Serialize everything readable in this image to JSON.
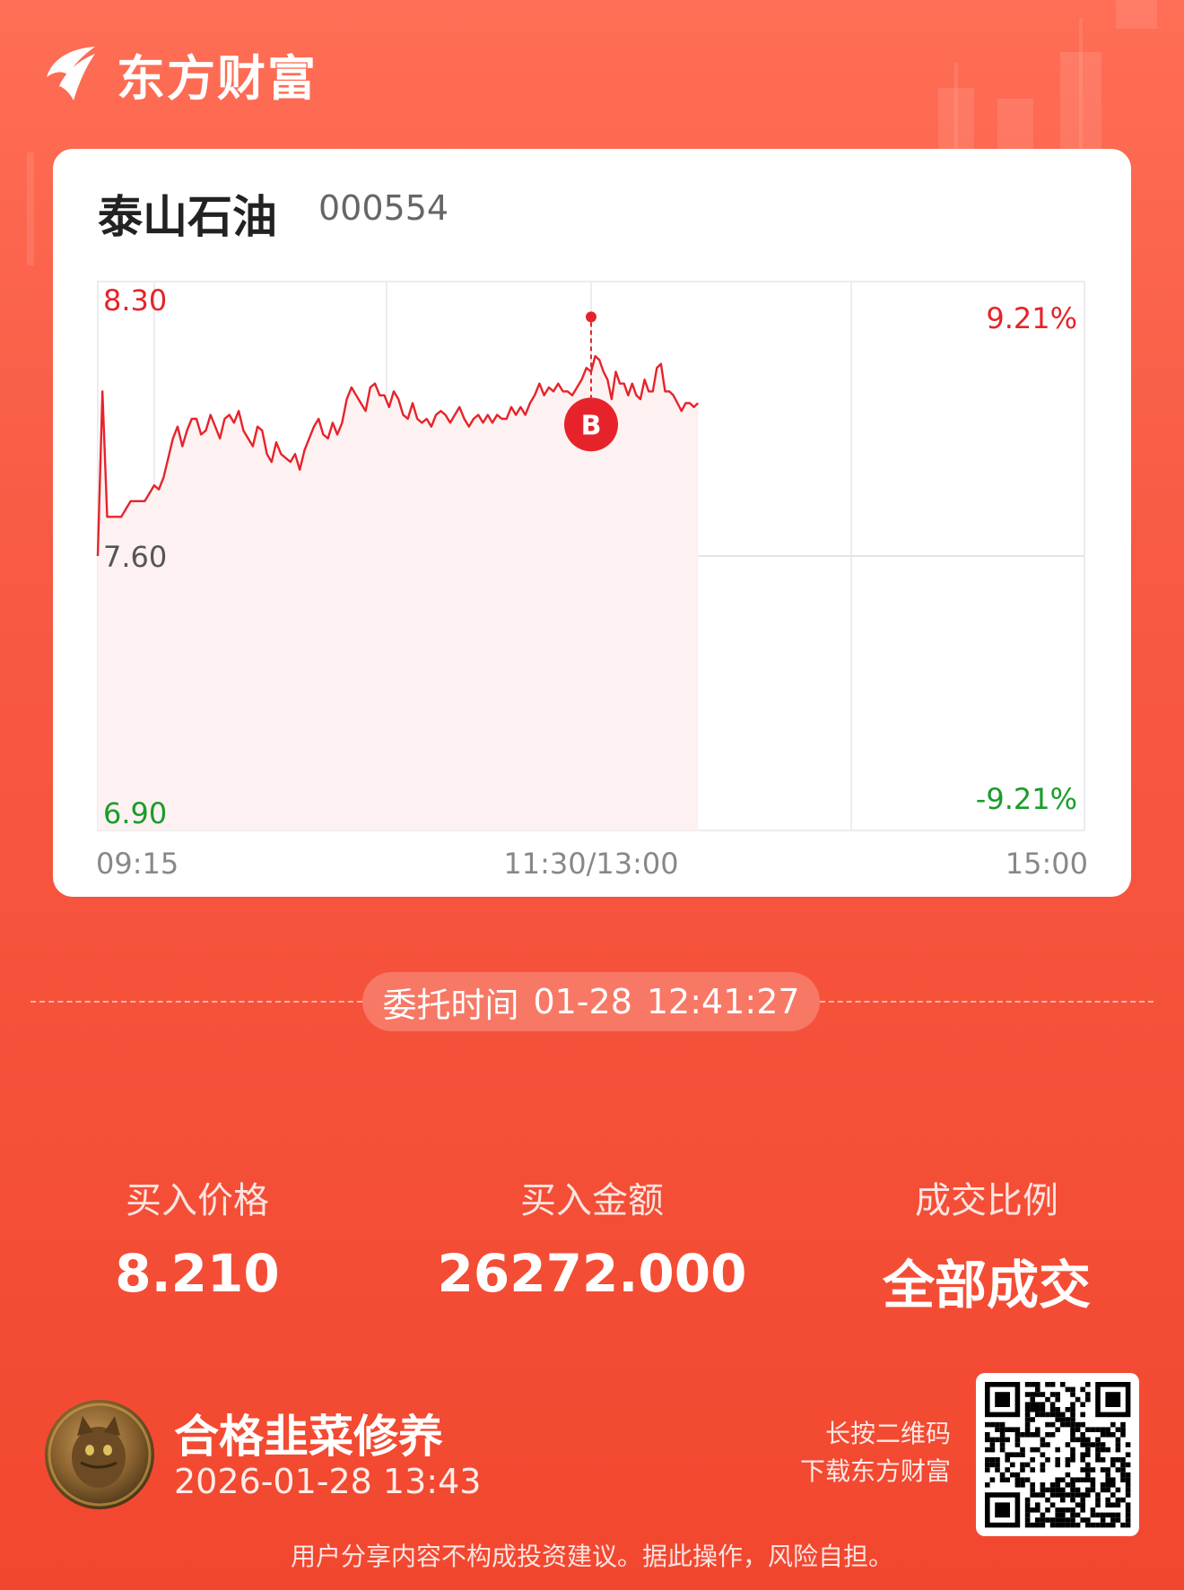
{
  "brand": {
    "name": "东方财富",
    "logo_icon": "eastmoney-logo-icon"
  },
  "stock": {
    "name": "泰山石油",
    "code": "000554"
  },
  "chart_data": {
    "type": "line",
    "title": "",
    "y_left_ticks": [
      "8.30",
      "7.60",
      "6.90"
    ],
    "y_right_ticks": [
      "9.21%",
      "-9.21%"
    ],
    "x_ticks": [
      "09:15",
      "11:30/13:00",
      "15:00"
    ],
    "ylim": [
      6.9,
      8.3
    ],
    "pre_close": 7.6,
    "colors": {
      "up": "#e6232b",
      "down": "#1a9c2a",
      "neutral": "#555555",
      "fill": "#fdf1f1",
      "grid": "#ececec"
    },
    "series": [
      {
        "values": [
          7.6,
          8.02,
          7.7,
          7.7,
          7.7,
          7.7,
          7.72,
          7.74,
          7.74,
          7.74,
          7.74,
          7.76,
          7.78,
          7.77,
          7.8,
          7.85,
          7.9,
          7.93,
          7.88,
          7.92,
          7.95,
          7.95,
          7.91,
          7.92,
          7.96,
          7.93,
          7.9,
          7.95,
          7.96,
          7.94,
          7.97,
          7.92,
          7.9,
          7.88,
          7.93,
          7.92,
          7.86,
          7.84,
          7.89,
          7.86,
          7.85,
          7.84,
          7.86,
          7.82,
          7.87,
          7.9,
          7.93,
          7.95,
          7.91,
          7.9,
          7.94,
          7.91,
          7.94,
          8.0,
          8.03,
          8.01,
          7.99,
          7.97,
          8.03,
          8.04,
          8.01,
          8.01,
          7.98,
          8.02,
          8.0,
          7.96,
          7.95,
          7.99,
          7.95,
          7.94,
          7.95,
          7.93,
          7.96,
          7.97,
          7.96,
          7.94,
          7.96,
          7.98,
          7.95,
          7.93,
          7.95,
          7.96,
          7.94,
          7.96,
          7.94,
          7.96,
          7.95,
          7.95,
          7.98,
          7.96,
          7.98,
          7.96,
          7.99,
          8.01,
          8.04,
          8.01,
          8.03,
          8.02,
          8.04,
          8.02,
          8.02,
          8.01,
          8.03,
          8.05,
          8.08,
          8.07,
          8.11,
          8.1,
          8.07,
          8.05,
          8.0,
          8.07,
          8.04,
          8.04,
          8.01,
          8.04,
          8.01,
          8.0,
          8.05,
          8.02,
          8.02,
          8.08,
          8.09,
          8.02,
          8.02,
          8.01,
          7.99,
          7.97,
          7.99,
          7.99,
          7.98,
          7.99
        ],
        "markers": [
          {
            "label": "B",
            "index": 105,
            "price": 8.21
          }
        ]
      }
    ],
    "session": {
      "morning_points": 106,
      "afternoon_points_total": 120
    }
  },
  "order": {
    "label": "委托时间",
    "date": "01-28",
    "time": "12:41:27"
  },
  "stats": [
    {
      "label": "买入价格",
      "value": "8.210"
    },
    {
      "label": "买入金额",
      "value": "26272.000"
    },
    {
      "label": "成交比例",
      "value": "全部成交"
    }
  ],
  "user": {
    "name": "合格韭菜修养",
    "time": "2026-01-28 13:43",
    "avatar_icon": "cat-avatar-icon"
  },
  "qr": {
    "line1": "长按二维码",
    "line2": "下载东方财富",
    "icon": "qr-code-icon"
  },
  "disclaimer": "用户分享内容不构成投资建议。据此操作，风险自担。"
}
